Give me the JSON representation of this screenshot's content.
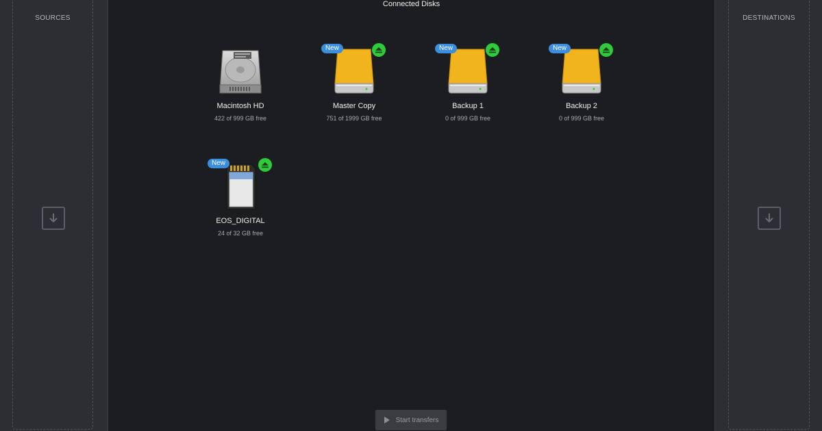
{
  "sources": {
    "title": "SOURCES",
    "drop_icon": "download-arrow-icon"
  },
  "destinations": {
    "title": "DESTINATIONS",
    "drop_icon": "download-arrow-icon"
  },
  "main": {
    "title": "Connected Disks",
    "disks": [
      {
        "name": "Macintosh HD",
        "free": "422 of 999 GB free",
        "icon": "internal-hdd-icon",
        "is_new": false,
        "ejectable": false
      },
      {
        "name": "Master Copy",
        "free": "751 of 1999 GB free",
        "icon": "external-drive-icon",
        "is_new": true,
        "ejectable": true
      },
      {
        "name": "Backup 1",
        "free": "0 of 999 GB free",
        "icon": "external-drive-icon",
        "is_new": true,
        "ejectable": true
      },
      {
        "name": "Backup 2",
        "free": "0 of 999 GB free",
        "icon": "external-drive-icon",
        "is_new": true,
        "ejectable": true
      },
      {
        "name": "EOS_DIGITAL",
        "free": "24 of 32 GB free",
        "icon": "sd-card-icon",
        "is_new": true,
        "ejectable": true
      }
    ],
    "new_badge_label": "New",
    "start_button": {
      "label": "Start transfers",
      "icon": "play-icon"
    }
  },
  "colors": {
    "background": "#1c1d20",
    "panel": "#2c2e33",
    "badge_blue": "#3b8ede",
    "eject_green": "#2ecb3a",
    "drive_yellow": "#f2b41c"
  }
}
